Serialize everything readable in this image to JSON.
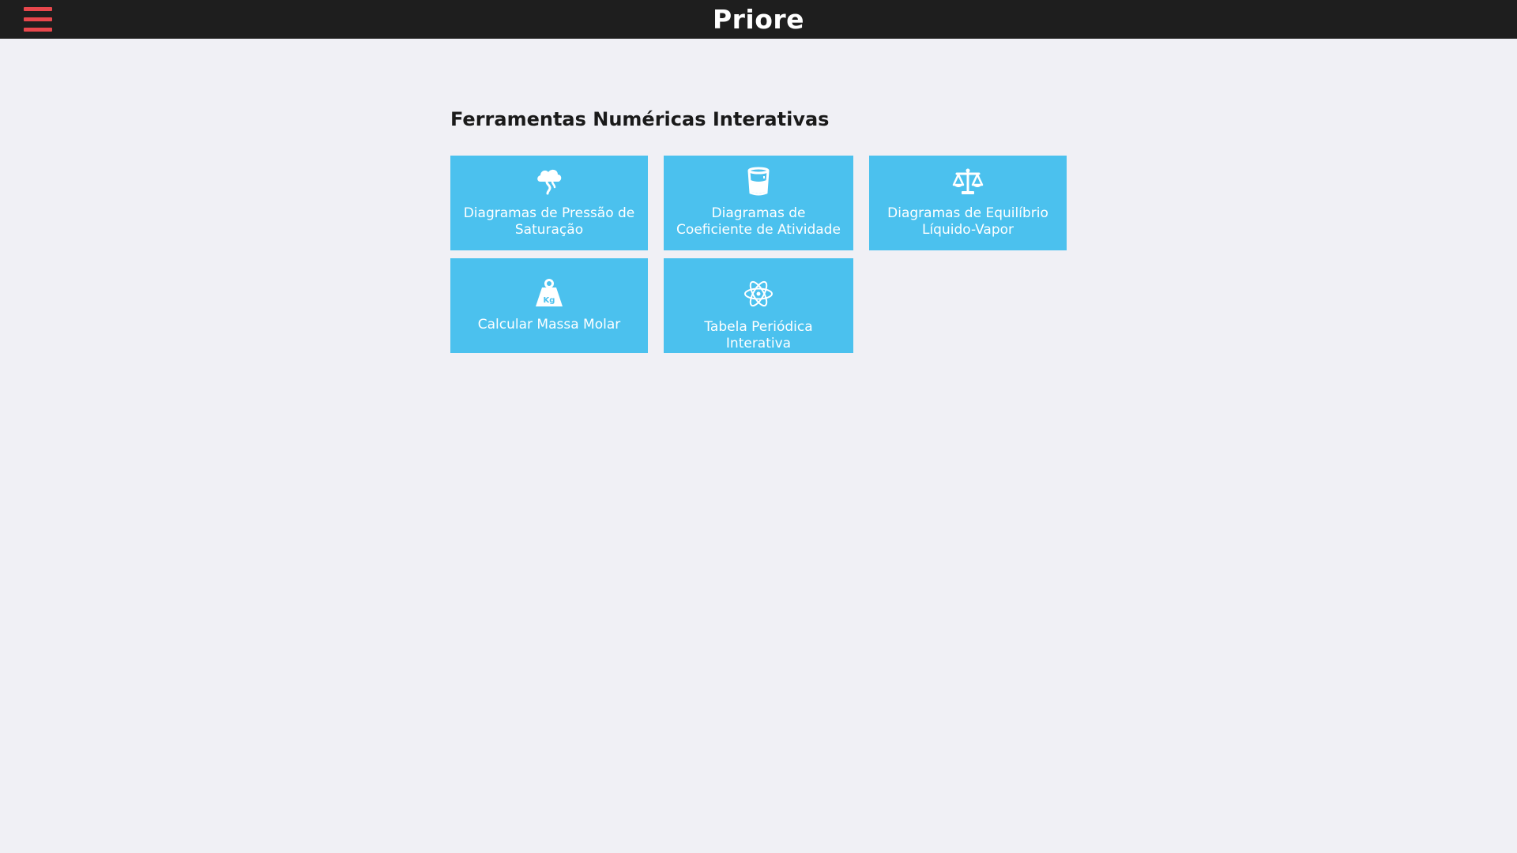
{
  "app": {
    "brand": "Priore"
  },
  "header": {
    "menu_icon": "hamburger-menu-icon",
    "menu_color": "#e8474c"
  },
  "main": {
    "section_title": "Ferramentas Numéricas Interativas",
    "tiles": [
      {
        "label": "Diagramas de Pressão de Saturação",
        "icon": "cloud-vapor-icon"
      },
      {
        "label": "Diagramas de Coeficiente de Atividade",
        "icon": "beaker-icon"
      },
      {
        "label": "Diagramas de Equilíbrio Líquido-Vapor",
        "icon": "balance-scale-icon"
      },
      {
        "label": "Calcular Massa Molar",
        "icon": "weight-kg-icon"
      },
      {
        "label": "Tabela Periódica Interativa",
        "icon": "atom-icon"
      }
    ]
  },
  "colors": {
    "topbar": "#1e1e1e",
    "background": "#f0f0f5",
    "tile": "#4bc1ee",
    "accent": "#e8474c"
  }
}
